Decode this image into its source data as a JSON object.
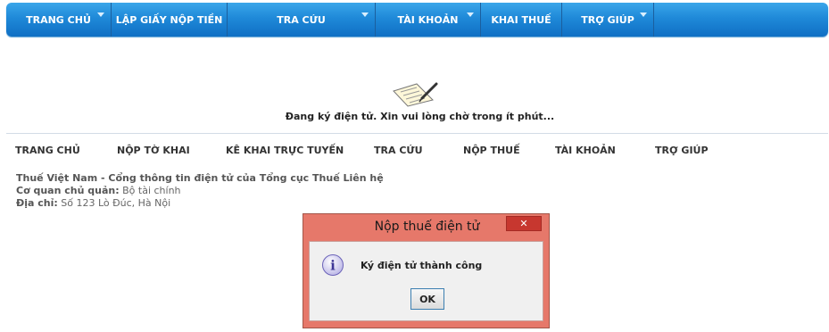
{
  "top_nav": {
    "items": [
      {
        "label": "TRANG CHỦ",
        "has_dropdown": true
      },
      {
        "label": "LẬP GIẤY NỘP TIỀN",
        "has_dropdown": false
      },
      {
        "label": "TRA CỨU",
        "has_dropdown": true
      },
      {
        "label": "TÀI KHOẢN",
        "has_dropdown": true
      },
      {
        "label": "KHAI THUẾ",
        "has_dropdown": false
      },
      {
        "label": "TRỢ GIÚP",
        "has_dropdown": true
      }
    ],
    "color": "#1f89d8"
  },
  "loading": {
    "icon": "signing-document-icon",
    "text": "Đang ký điện tử. Xin vui lòng chờ trong ít phút..."
  },
  "sub_nav": {
    "items": [
      "TRANG CHỦ",
      "NỘP TỜ KHAI",
      "KÊ KHAI TRỰC TUYẾN",
      "TRA CỨU",
      "NỘP THUẾ",
      "TÀI KHOẢN",
      "TRỢ GIÚP"
    ]
  },
  "footer": {
    "portal_title": "Thuế Việt Nam - Cổng thông tin điện tử của Tổng cục Thuế Liên hệ",
    "agency_label": "Cơ quan chủ quản:",
    "agency_value": "Bộ tài chính",
    "address_label": "Địa chỉ:",
    "address_value": "Số 123 Lò Đúc, Hà Nội"
  },
  "dialog": {
    "title": "Nộp thuế điện tử",
    "close_label": "✕",
    "icon": "info-icon",
    "message": "Ký điện tử thành công",
    "ok_label": "OK",
    "title_bar_color": "#e6786a",
    "close_color": "#c7372f"
  }
}
